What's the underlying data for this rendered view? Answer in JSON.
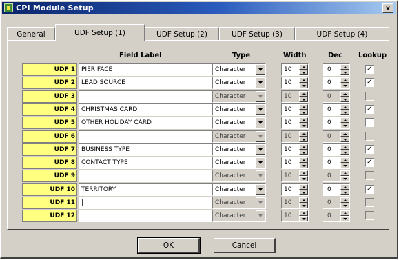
{
  "window": {
    "title": "CPI Module Setup",
    "close_glyph": "x"
  },
  "tabs": [
    {
      "label": "General"
    },
    {
      "label": "UDF Setup (1)"
    },
    {
      "label": "UDF Setup (2)"
    },
    {
      "label": "UDF Setup (3)"
    },
    {
      "label": "UDF Setup (4)"
    }
  ],
  "headers": {
    "field_label": "Field Label",
    "type": "Type",
    "width": "Width",
    "dec": "Dec",
    "lookup": "Lookup"
  },
  "rows": [
    {
      "udf": "UDF 1",
      "label": "PIER FACE",
      "type": "Character",
      "width": "10",
      "dec": "0",
      "lookup": true,
      "enabled": true
    },
    {
      "udf": "UDF 2",
      "label": "LEAD SOURCE",
      "type": "Character",
      "width": "10",
      "dec": "0",
      "lookup": true,
      "enabled": true
    },
    {
      "udf": "UDF 3",
      "label": "",
      "type": "Character",
      "width": "10",
      "dec": "0",
      "lookup": false,
      "enabled": false
    },
    {
      "udf": "UDF 4",
      "label": "CHRISTMAS CARD",
      "type": "Character",
      "width": "10",
      "dec": "0",
      "lookup": true,
      "enabled": true
    },
    {
      "udf": "UDF 5",
      "label": "OTHER HOLIDAY CARD",
      "type": "Character",
      "width": "10",
      "dec": "0",
      "lookup": false,
      "enabled": true
    },
    {
      "udf": "UDF 6",
      "label": "",
      "type": "Character",
      "width": "10",
      "dec": "0",
      "lookup": false,
      "enabled": false
    },
    {
      "udf": "UDF 7",
      "label": "BUSINESS TYPE",
      "type": "Character",
      "width": "10",
      "dec": "0",
      "lookup": true,
      "enabled": true
    },
    {
      "udf": "UDF 8",
      "label": "CONTACT TYPE",
      "type": "Character",
      "width": "10",
      "dec": "0",
      "lookup": true,
      "enabled": true
    },
    {
      "udf": "UDF 9",
      "label": "",
      "type": "Character",
      "width": "10",
      "dec": "0",
      "lookup": false,
      "enabled": false
    },
    {
      "udf": "UDF 10",
      "label": "TERRITORY",
      "type": "Character",
      "width": "10",
      "dec": "0",
      "lookup": true,
      "enabled": true
    },
    {
      "udf": "UDF 11",
      "label": "|",
      "type": "Character",
      "width": "10",
      "dec": "0",
      "lookup": false,
      "enabled": false
    },
    {
      "udf": "UDF 12",
      "label": "",
      "type": "Character",
      "width": "10",
      "dec": "0",
      "lookup": false,
      "enabled": false
    }
  ],
  "buttons": {
    "ok": "OK",
    "cancel": "Cancel"
  },
  "checkmark_glyph": "✓"
}
